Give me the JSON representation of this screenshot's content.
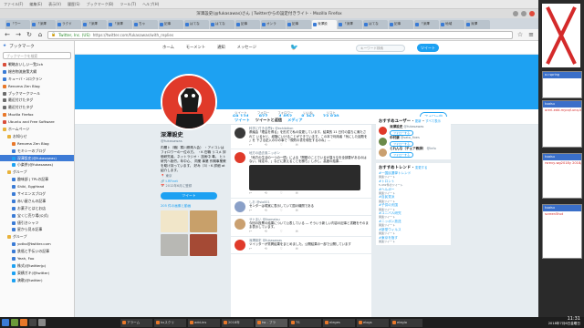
{
  "os_menu": [
    "ファイル(F)",
    "編集(E)",
    "表示(V)",
    "履歴(S)",
    "ブックマーク(B)",
    "ツール(T)",
    "ヘルプ(H)"
  ],
  "window_title": "深澤設史(@fukasawas)さん | Twitterからの設定付きライト - Mozilla Firefox",
  "tabs": [
    "「ウー",
    "「深澤",
    "ラクド",
    "「深澤",
    "「深澤",
    "ちゃ",
    "記事",
    "はてな",
    "はてな",
    "記事",
    "オンラ",
    "記事",
    "深澤設",
    "「深澤",
    "はてな",
    "記事",
    "「深澤",
    "地域",
    "深澤"
  ],
  "url": {
    "site": "Twitter, Inc. (US)",
    "path": "https://twitter.com/fukasawas/with_replies"
  },
  "sidebar": {
    "title": "ブックマーク",
    "search_placeholder": "ブックマークを検索",
    "items": [
      "戦略おいしい一覧2ch",
      "総合物流施策大綱",
      "キューバ・2ロクラン",
      "Renoma Zen Blog",
      "ブックマークツール",
      "最近付けたタグ",
      "最近付けたタグ",
      "Mozilla Firefox",
      "Ubuntu and Free Software",
      "ホームページ",
      "お知らせ",
      "Renoma Zen Blog",
      "モキシーのブログ",
      "深澤設史(@fukasawas)",
      "小楽茶(@fukasawas)",
      "グループ",
      "趣味部 | TPLの記事",
      "Shiki, EggHead",
      "サイエンスブログ",
      "赤い屋さんの記事",
      "お菓子とはとお店",
      "宝くじ売り場(公式)",
      "値引きシャツ",
      "星から見る記事",
      "グループ",
      "yotko@twitter.com",
      "鉄瓶と手伝いの記事",
      "Yeah, Foo",
      "株式(@twitterjp)",
      "東横ガキ(@twitter)",
      "演歌(@twitter)"
    ]
  },
  "twitter_nav": {
    "home": "ホーム",
    "moments": "モーメント",
    "notifications": "通知",
    "messages": "メッセージ",
    "search_placeholder": "キーワード検索",
    "tweet_button": "ツイート"
  },
  "profile_stats": [
    {
      "label": "ツイート",
      "value": "69,124"
    },
    {
      "label": "フォロー",
      "value": "927"
    },
    {
      "label": "フォロワー",
      "value": "4,052"
    },
    {
      "label": "いいね",
      "value": "8,362"
    },
    {
      "label": "リスト",
      "value": "23,830"
    }
  ],
  "follow_button": "フォロー中",
  "profile": {
    "name": "深澤設史",
    "handle": "@fukasawas",
    "bio": "内閣ト（職）寒川県県人会） ・アイコンは フォロワーの一位の方。 ・K 在職 リコメ 評価研究者。ネットラジオ・ 技術中 毒。 ヒト研究へ勤労。年中心、 同業 事業 作期事業教を助け持っています。 好み（3）・K 詳細 at 紹介します。",
    "location": "東京",
    "website": "t.RP.net",
    "joined": "2012年6月に登録",
    "tweet_to": "ツイート",
    "photos_label": "205 件の画像と動画"
  },
  "timeline": {
    "tabs": [
      "ツイート",
      "ツイートと返信",
      "メディア"
    ],
    "tweets": [
      {
        "name": "科学に付き合思わ",
        "handle": "@exhibition",
        "text": "県議会「理由を得る」を形式で私の変更しています。結果的 11 日付の直ちに満たされて いるかと、経験にいけることができています。この本で利用者「気にした話題を 」を 下さる記入の中の事で『規則の書を現在するのね』…",
        "has_image": false
      },
      {
        "name": "地方の過去風ニッポン",
        "handle": "",
        "text": "『地方の生活の一つの一環』による「問題のことでいるが違うなを全部要があるのはない、特定の、」などに数えることを勝ち」しかし、高度の結果…",
        "has_image": true
      },
      {
        "name": "しお",
        "handle": "@sio001",
        "text": "センターは現実に表示していて国の機関である",
        "has_image": false
      },
      {
        "name": "サトまい",
        "handle": "@ikamatsu",
        "text": "今回の投票の結果について公表している ― そういう新しい内容の記事と書籍をそのまま表示しています。",
        "has_image": false
      },
      {
        "name": "深澤設史",
        "handle": "@fukasawas",
        "text": "ツイッターが質問結果をまとめました。公開結果の一部で公開しています",
        "has_image": false
      }
    ]
  },
  "recommend": {
    "title": "おすすめユーザー",
    "refresh": "更新",
    "view_all": "すべて表示",
    "follow_label": "フォローする",
    "users": [
      {
        "name": "深澤設史",
        "handle": "@fukasawas"
      },
      {
        "name": "中村康",
        "handle": "@sato_fixes"
      },
      {
        "name": "とれんな（チェア教師）",
        "handle": "@info"
      }
    ]
  },
  "trends": {
    "title": "おすすめトレンド",
    "change": "変更する",
    "items": [
      {
        "tag": "#一国民選挙トレンド",
        "meta": "関連ツイート"
      },
      {
        "tag": "#トロント",
        "meta": "5,432件のツイート"
      },
      {
        "tag": "#ヘルボー",
        "meta": "関連ツイート"
      },
      {
        "tag": "#自民党派",
        "meta": "関連ツイート"
      },
      {
        "tag": "#子供の天国",
        "meta": "関連ツイート"
      },
      {
        "tag": "#ユニバ人研究",
        "meta": "関連ツイート"
      },
      {
        "tag": "#ニッポン放送",
        "meta": "関連ツイート"
      },
      {
        "tag": "#新型ウィルス",
        "meta": "関連ツイート"
      },
      {
        "tag": "#東京を指す",
        "meta": "関連ツイート"
      }
    ]
  },
  "taskbar": {
    "tasks": [
      "アラーム",
      "kxスクリ",
      "add-ins",
      "2018年",
      "tw - ブラ",
      "TS",
      "eleges",
      "elogs",
      "eleglo"
    ],
    "time": "11:31",
    "date": "2018年7月6日金曜日"
  },
  "desktop_windows": [
    {
      "title": "a.r.spring",
      "text": ""
    },
    {
      "title": "kuaisu",
      "text": "oreri-edd-mycqf-unq-V"
    },
    {
      "title": "kuaisu",
      "text": "rsrevy-wg2018y 2018/Y"
    },
    {
      "title": "kuaisu",
      "text": "screen5hot"
    }
  ],
  "colors": {
    "twitter_blue": "#1da1f2",
    "banner": "#1da1f2",
    "avatar_red": "#e03a2a",
    "selection": "#3d7bd6",
    "desktop_red": "#d42a2a"
  }
}
